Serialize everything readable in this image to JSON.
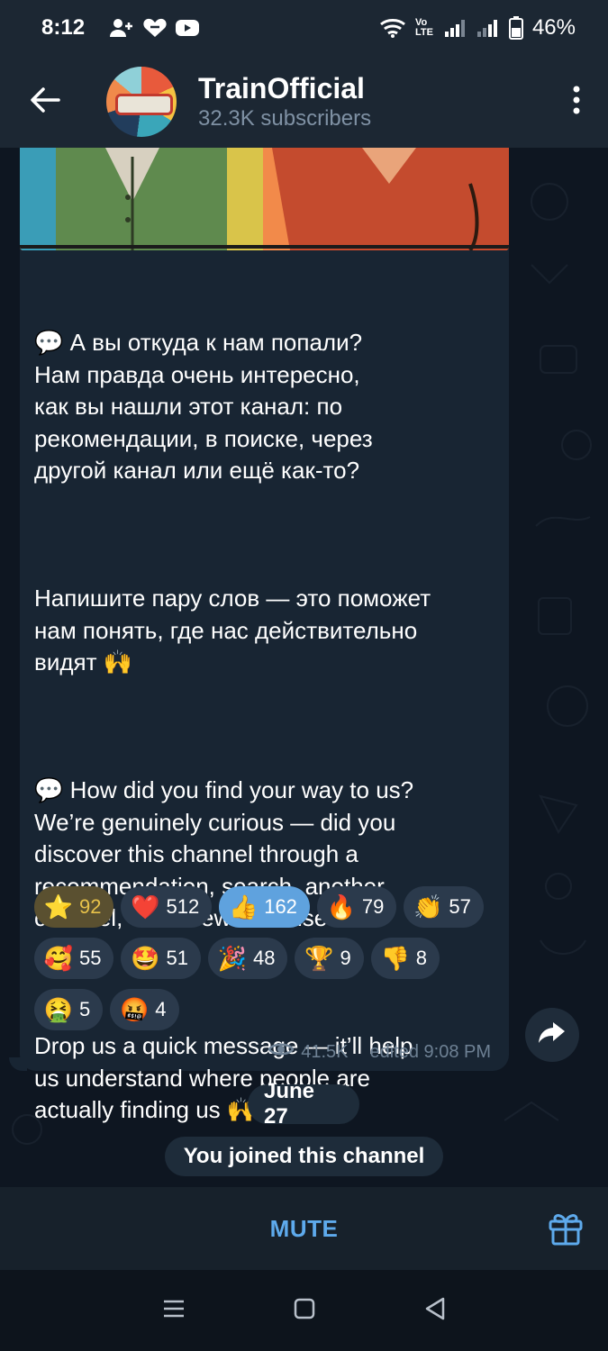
{
  "status_bar": {
    "time": "8:12",
    "battery": "46%",
    "network_label": "Vo LTE"
  },
  "header": {
    "channel_name": "TrainOfficial",
    "subscribers": "32.3K subscribers"
  },
  "message": {
    "paragraphs": [
      "💬 А вы откуда к нам попали?\nНам правда очень интересно,\nкак вы нашли этот канал: по\nрекомендации, в поиске, через\nдругой канал или ещё как-то?",
      "Напишите пару слов — это поможет\nнам понять, где нас действительно\nвидят 🙌",
      "💬 How did you find your way to us?\nWe’re genuinely curious — did you\ndiscover this channel through a\nrecommendation, search, another\nchannel, or somewhere else?",
      "Drop us a quick message — it’ll help\nus understand where people are\nactually finding us 🙌"
    ],
    "reactions": [
      {
        "emoji": "⭐",
        "count": "92",
        "style": "gold"
      },
      {
        "emoji": "❤️",
        "count": "512",
        "style": ""
      },
      {
        "emoji": "👍",
        "count": "162",
        "style": "active"
      },
      {
        "emoji": "🔥",
        "count": "79",
        "style": ""
      },
      {
        "emoji": "👏",
        "count": "57",
        "style": ""
      },
      {
        "emoji": "🥰",
        "count": "55",
        "style": ""
      },
      {
        "emoji": "🤩",
        "count": "51",
        "style": ""
      },
      {
        "emoji": "🎉",
        "count": "48",
        "style": ""
      },
      {
        "emoji": "🏆",
        "count": "9",
        "style": ""
      },
      {
        "emoji": "👎",
        "count": "8",
        "style": ""
      },
      {
        "emoji": "🤮",
        "count": "5",
        "style": ""
      },
      {
        "emoji": "🤬",
        "count": "4",
        "style": ""
      }
    ],
    "views": "41.5K",
    "edited": "edited 9:08 PM"
  },
  "service": {
    "date": "June 27",
    "joined": "You joined this channel"
  },
  "bottom": {
    "mute_label": "MUTE"
  },
  "colors": {
    "accent": "#5eaaec",
    "bubble": "#182533",
    "background": "#0e1621"
  }
}
